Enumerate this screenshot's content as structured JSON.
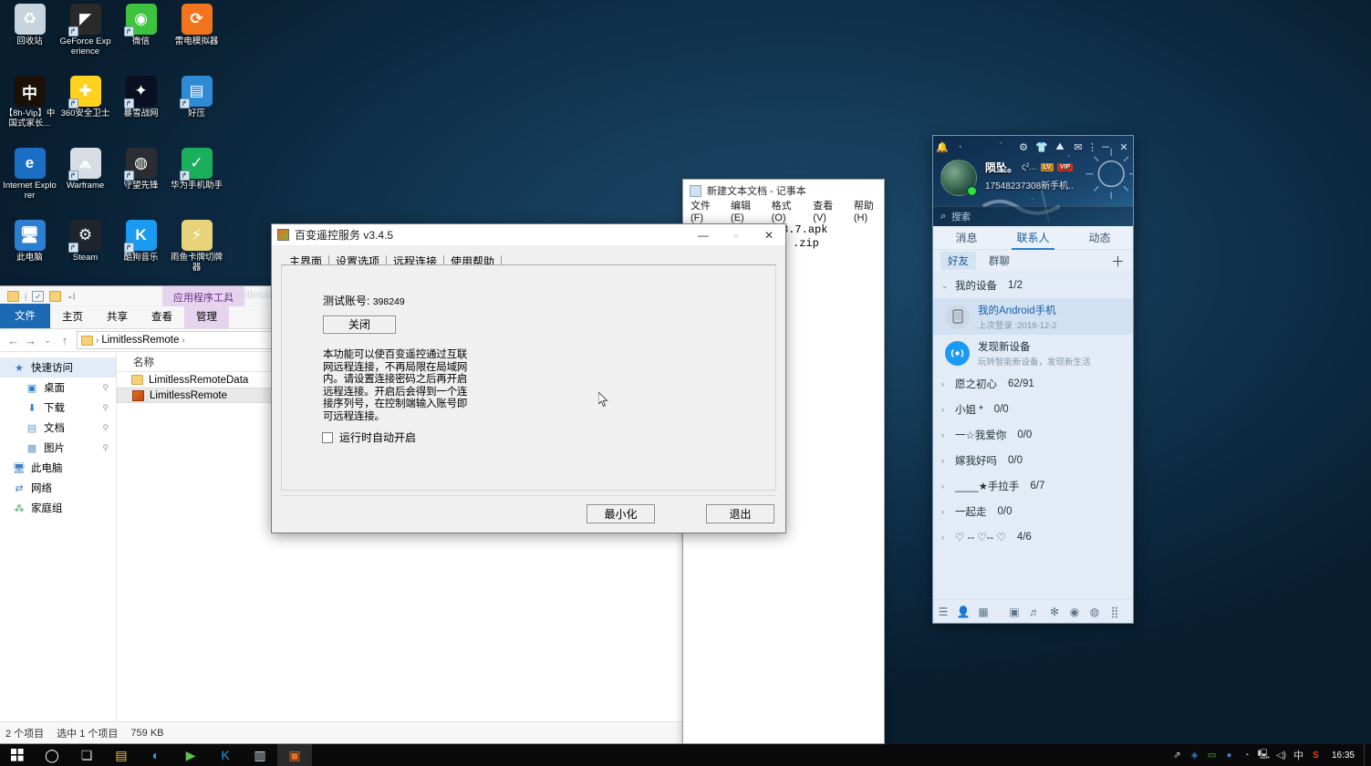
{
  "desktop": {
    "icons": [
      {
        "label": "回收站",
        "icon": "recycle-bin-icon",
        "color": "#c7d3dd",
        "glyph": "♻",
        "shortcut": false
      },
      {
        "label": "GeForce Experience",
        "icon": "geforce-experience-icon",
        "color": "#2a2a2a",
        "glyph": "◤",
        "shortcut": true
      },
      {
        "label": "微信",
        "icon": "wechat-icon",
        "color": "#3ec33e",
        "glyph": "◉",
        "shortcut": true
      },
      {
        "label": "雷电模拟器",
        "icon": "ldplayer-icon",
        "color": "#f2751e",
        "glyph": "⟳",
        "shortcut": false
      },
      {
        "label": "【8h-Vip】中国式家长...",
        "icon": "chinese-parents-game-icon",
        "color": "#1b1008",
        "glyph": "中",
        "shortcut": false
      },
      {
        "label": "360安全卫士",
        "icon": "360-security-icon",
        "color": "#ffd21e",
        "glyph": "✚",
        "shortcut": true
      },
      {
        "label": "暴雪战网",
        "icon": "battlenet-icon",
        "color": "#0a0f22",
        "glyph": "✦",
        "shortcut": true
      },
      {
        "label": "好压",
        "icon": "haozip-icon",
        "color": "#2f8ad6",
        "glyph": "▤",
        "shortcut": true
      },
      {
        "label": "Internet Explorer",
        "icon": "internet-explorer-icon",
        "color": "#1a6fc4",
        "glyph": "e",
        "shortcut": false
      },
      {
        "label": "Warframe",
        "icon": "warframe-icon",
        "color": "#d7dde2",
        "glyph": "⩕",
        "shortcut": true
      },
      {
        "label": "守望先锋",
        "icon": "overwatch-icon",
        "color": "#2a2e33",
        "glyph": "◍",
        "shortcut": true
      },
      {
        "label": "华为手机助手",
        "icon": "huawei-hisuite-icon",
        "color": "#1aaf5d",
        "glyph": "✓",
        "shortcut": true
      },
      {
        "label": "此电脑",
        "icon": "this-pc-icon",
        "color": "#2b7fd0",
        "glyph": "🖥",
        "shortcut": false
      },
      {
        "label": "Steam",
        "icon": "steam-icon",
        "color": "#20252c",
        "glyph": "⚙",
        "shortcut": true
      },
      {
        "label": "酷狗音乐",
        "icon": "kugou-music-icon",
        "color": "#1a9af0",
        "glyph": "K",
        "shortcut": true
      },
      {
        "label": "雨鱼卡牌切牌器",
        "icon": "card-shuffler-icon",
        "color": "#e8d37a",
        "glyph": "⚡",
        "shortcut": false
      }
    ]
  },
  "explorer": {
    "quick_access_icons": [
      "folder-icon",
      "properties-icon",
      "new-folder-icon",
      "customize-dropdown-icon"
    ],
    "context_tab_header": "应用程序工具",
    "context_title_partial": "LimitlessR",
    "ribbon_tabs": [
      {
        "label": "文件",
        "active": true
      },
      {
        "label": "主页",
        "active": false
      },
      {
        "label": "共享",
        "active": false
      },
      {
        "label": "查看",
        "active": false
      },
      {
        "label": "管理",
        "active": false
      }
    ],
    "address": {
      "path_segments": [
        "LimitlessRemote"
      ],
      "back_icon": "back-arrow-icon",
      "forward_icon": "forward-arrow-icon",
      "recent_icon": "recent-locations-icon",
      "up_icon": "up-arrow-icon"
    },
    "nav_pane": [
      {
        "label": "快速访问",
        "icon": "star-icon",
        "selected": true,
        "pinned": false,
        "indent": false
      },
      {
        "label": "桌面",
        "icon": "desktop-icon",
        "selected": false,
        "pinned": true,
        "indent": true
      },
      {
        "label": "下载",
        "icon": "downloads-icon",
        "selected": false,
        "pinned": true,
        "indent": true
      },
      {
        "label": "文档",
        "icon": "documents-icon",
        "selected": false,
        "pinned": true,
        "indent": true
      },
      {
        "label": "图片",
        "icon": "pictures-icon",
        "selected": false,
        "pinned": true,
        "indent": true
      },
      {
        "label": "此电脑",
        "icon": "this-pc-icon",
        "selected": false,
        "pinned": false,
        "indent": false
      },
      {
        "label": "网络",
        "icon": "network-icon",
        "selected": false,
        "pinned": false,
        "indent": false
      },
      {
        "label": "家庭组",
        "icon": "homegroup-icon",
        "selected": false,
        "pinned": false,
        "indent": false
      }
    ],
    "column_header": "名称",
    "files": [
      {
        "name": "LimitlessRemoteData",
        "type": "folder",
        "selected": false
      },
      {
        "name": "LimitlessRemote",
        "type": "application",
        "selected": true
      }
    ],
    "status": {
      "item_count": "2 个项目",
      "selection": "选中 1 个项目",
      "size": "759 KB"
    },
    "view_modes": [
      {
        "name": "details-view-icon",
        "active": true
      },
      {
        "name": "large-icons-view-icon",
        "active": false
      }
    ]
  },
  "notepad": {
    "title": "新建文本文档 - 记事本",
    "icon": "notepad-icon",
    "menu": [
      "文件(F)",
      "编辑(E)",
      "格式(O)",
      "查看(V)",
      "帮助(H)"
    ],
    "content_lines": [
      "LimitlessRemote3.7.apk",
      ".zip"
    ]
  },
  "dialog": {
    "title": "百变遥控服务 v3.4.5",
    "window_controls": {
      "minimize": "—",
      "maximize": "▫",
      "close": "✕"
    },
    "tabs": [
      {
        "label": "主界面",
        "active": false
      },
      {
        "label": "设置选项",
        "active": false
      },
      {
        "label": "远程连接",
        "active": true
      },
      {
        "label": "使用帮助",
        "active": false
      }
    ],
    "account_label": "测试账号:",
    "account_number": "398249",
    "close_button": "关闭",
    "description": "本功能可以使百变遥控通过互联网远程连接，不再局限在局域网内。请设置连接密码之后再开启远程连接。开启后会得到一个连接序列号，在控制端输入账号即可远程连接。",
    "autostart_label": "运行时自动开启",
    "autostart_checked": false,
    "minimize_button": "最小化",
    "exit_button": "退出"
  },
  "qq": {
    "top_icons": [
      "bell-icon",
      "settings-gear-icon",
      "dress-up-icon",
      "pyramid-icon",
      "mail-icon",
      "more-dots-icon",
      "minimize-icon",
      "close-icon"
    ],
    "avatar": "user-avatar",
    "nickname": "陨坠。",
    "nickname_suffix": "ς²...",
    "badges": [
      {
        "type": "level",
        "label": "LV"
      },
      {
        "type": "vip",
        "label": "VIP"
      }
    ],
    "signature": "17548237308新手机..",
    "search_placeholder": "搜索",
    "search_icon": "search-icon",
    "tabs": [
      {
        "label": "消息",
        "active": false
      },
      {
        "label": "联系人",
        "active": true
      },
      {
        "label": "动态",
        "active": false
      }
    ],
    "subtabs": [
      {
        "label": "好友",
        "active": true
      },
      {
        "label": "群聊",
        "active": false
      }
    ],
    "add_icon": "plus-icon",
    "my_device_group": {
      "label": "我的设备",
      "count": "1/2"
    },
    "devices": [
      {
        "name": "我的Android手机",
        "detail": "上次登录 :2018-12-2",
        "icon": "phone-icon",
        "selected": true
      },
      {
        "name": "发现新设备",
        "detail": "玩转智能新设备，发现新生活",
        "icon": "discover-device-icon",
        "selected": false
      }
    ],
    "groups": [
      {
        "label": "愿之初心",
        "count": "62/91"
      },
      {
        "label": "小姐 *",
        "count": "0/0"
      },
      {
        "label": "一☆我爱你",
        "count": "0/0"
      },
      {
        "label": "嫁我好吗",
        "count": "0/0"
      },
      {
        "label": "____★手拉手",
        "count": "6/7"
      },
      {
        "label": "一起走",
        "count": "0/0"
      },
      {
        "label": "♡ -- ♡-- ♡",
        "count": "4/6"
      }
    ],
    "bottom_icons": [
      "menu-icon",
      "add-friend-icon",
      "group-icon",
      "qq-space-icon",
      "qq-music-icon",
      "app-manager-icon",
      "mail-icon",
      "game-icon",
      "more-apps-icon"
    ]
  },
  "taskbar": {
    "start_icon": "windows-start-icon",
    "items": [
      {
        "name": "cortana-search-icon",
        "glyph": "◯",
        "color": "#ffffff",
        "active": false
      },
      {
        "name": "task-view-icon",
        "glyph": "❏",
        "color": "#d8d8d8",
        "active": false
      },
      {
        "name": "file-explorer-taskbar-icon",
        "glyph": "▤",
        "color": "#f0c04a",
        "active": false
      },
      {
        "name": "browser-taskbar-icon",
        "glyph": "◐",
        "color": "#2d9fe0",
        "active": false
      },
      {
        "name": "media-player-taskbar-icon",
        "glyph": "▶",
        "color": "#5cc24a",
        "active": false
      },
      {
        "name": "kugou-taskbar-icon",
        "glyph": "K",
        "color": "#1a9af0",
        "active": false
      },
      {
        "name": "notepad-taskbar-icon",
        "glyph": "▥",
        "color": "#cfe0f0",
        "active": false
      },
      {
        "name": "remote-service-taskbar-icon",
        "glyph": "▣",
        "color": "#e8701e",
        "active": true
      }
    ],
    "tray_icons": [
      {
        "name": "share-tray-icon",
        "glyph": "⇗"
      },
      {
        "name": "antivirus-tray-icon",
        "glyph": "◈",
        "color": "#2b7fd0"
      },
      {
        "name": "green-app-tray-icon",
        "glyph": "▭",
        "color": "#5cc24a"
      },
      {
        "name": "blue-app-tray-icon",
        "glyph": "●",
        "color": "#3b7cc4"
      },
      {
        "name": "driver-tray-icon",
        "glyph": "◔",
        "color": "#9aa7b2"
      },
      {
        "name": "network-tray-icon",
        "glyph": "🖳"
      },
      {
        "name": "volume-tray-icon",
        "glyph": "🔊"
      },
      {
        "name": "ime-tray-icon",
        "glyph": "中"
      },
      {
        "name": "sogou-tray-icon",
        "glyph": "S",
        "color": "#e8442a"
      }
    ],
    "clock_time": "16:35"
  }
}
